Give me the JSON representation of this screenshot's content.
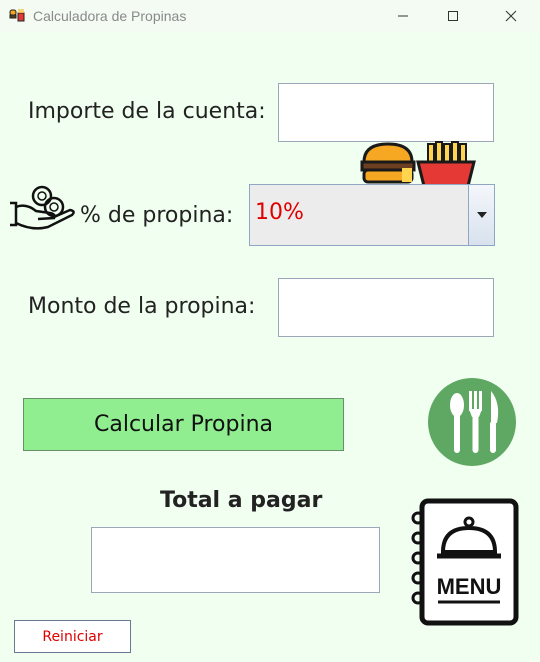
{
  "window": {
    "title": "Calculadora de Propinas",
    "icons": {
      "app": "food-icon",
      "minimize": "minimize-icon",
      "maximize": "maximize-icon",
      "close": "close-icon"
    }
  },
  "form": {
    "bill_label": "Importe de la cuenta:",
    "bill_value": "",
    "tip_percent_label": "% de propina:",
    "tip_percent_selected": "10%",
    "tip_amount_label": "Monto de la propina:",
    "tip_amount_value": "",
    "calculate_label": "Calcular Propina",
    "total_label": "Total a pagar",
    "total_value": "",
    "reset_label": "Reiniciar"
  },
  "colors": {
    "background": "#f0fff0",
    "calculate_button": "#90ee90",
    "combo_value_text": "#e00000",
    "reset_text": "#e00000",
    "cutlery_circle": "#5fa863"
  },
  "decorations": {
    "hand_icon": "hand-coins-icon",
    "food_icon": "burger-fries-icon",
    "cutlery_icon": "cutlery-icon",
    "menu_icon": "menu-book-icon",
    "menu_text": "MENU"
  }
}
